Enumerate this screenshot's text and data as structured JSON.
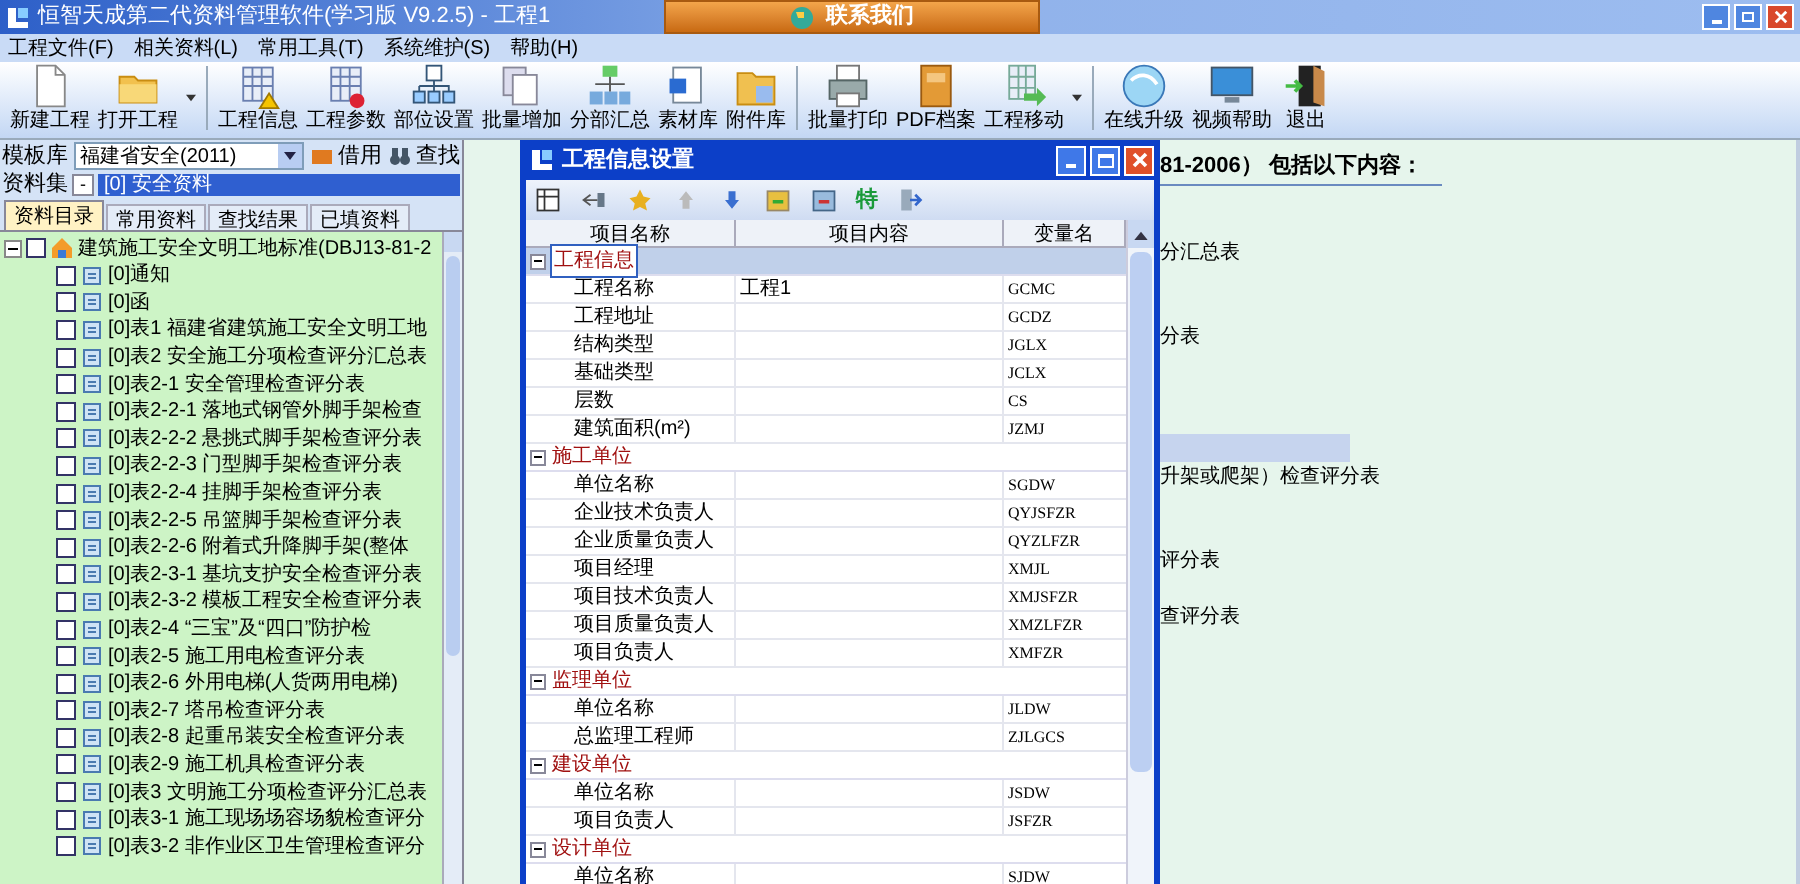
{
  "window": {
    "title": "恒智天成第二代资料管理软件(学习版 V9.2.5) - 工程1",
    "contact_button": "联系我们"
  },
  "menu": [
    "工程文件(F)",
    "相关资料(L)",
    "常用工具(T)",
    "系统维护(S)",
    "帮助(H)"
  ],
  "toolbar": [
    {
      "label": "新建工程"
    },
    {
      "label": "打开工程",
      "dropdown": true
    },
    {
      "label": "工程信息",
      "separator_before": true
    },
    {
      "label": "工程参数"
    },
    {
      "label": "部位设置"
    },
    {
      "label": "批量增加"
    },
    {
      "label": "分部汇总"
    },
    {
      "label": "素材库"
    },
    {
      "label": "附件库"
    },
    {
      "label": "批量打印",
      "separator_before": true
    },
    {
      "label": "PDF档案"
    },
    {
      "label": "工程移动",
      "dropdown": true
    },
    {
      "label": "在线升级",
      "separator_before": true
    },
    {
      "label": "视频帮助"
    },
    {
      "label": "退出"
    }
  ],
  "left_panel": {
    "template_label": "模板库",
    "template_value": "福建省安全(2011)",
    "borrow_button": "借用",
    "find_button": "查找",
    "set_label": "资料集",
    "set_toggle": "-",
    "set_value": "[0] 安全资料",
    "tabs": [
      {
        "label": "资料目录",
        "selected": true
      },
      {
        "label": "常用资料",
        "selected": false
      },
      {
        "label": "查找结果",
        "selected": false
      },
      {
        "label": "已填资料",
        "selected": false
      }
    ],
    "tree": {
      "label": "建筑施工安全文明工地标准(DBJ13-81-2",
      "expanded": true,
      "checked": false,
      "children": [
        {
          "label": "[0]通知",
          "checked": false
        },
        {
          "label": "[0]函",
          "checked": false
        },
        {
          "label": "[0]表1 福建省建筑施工安全文明工地",
          "checked": false
        },
        {
          "label": "[0]表2 安全施工分项检查评分汇总表",
          "checked": false
        },
        {
          "label": "[0]表2-1 安全管理检查评分表",
          "checked": false
        },
        {
          "label": "[0]表2-2-1 落地式钢管外脚手架检查",
          "checked": false
        },
        {
          "label": "[0]表2-2-2 悬挑式脚手架检查评分表",
          "checked": false
        },
        {
          "label": "[0]表2-2-3 门型脚手架检查评分表",
          "checked": false
        },
        {
          "label": "[0]表2-2-4 挂脚手架检查评分表",
          "checked": false
        },
        {
          "label": "[0]表2-2-5 吊篮脚手架检查评分表",
          "checked": false
        },
        {
          "label": "[0]表2-2-6 附着式升降脚手架(整体",
          "checked": false
        },
        {
          "label": "[0]表2-3-1 基坑支护安全检查评分表",
          "checked": false
        },
        {
          "label": "[0]表2-3-2 模板工程安全检查评分表",
          "checked": false
        },
        {
          "label": "[0]表2-4 “三宝”及“四口”防护检",
          "checked": false
        },
        {
          "label": "[0]表2-5 施工用电检查评分表",
          "checked": false
        },
        {
          "label": "[0]表2-6 外用电梯(人货两用电梯)",
          "checked": false
        },
        {
          "label": "[0]表2-7 塔吊检查评分表",
          "checked": false
        },
        {
          "label": "[0]表2-8 起重吊装安全检查评分表",
          "checked": false
        },
        {
          "label": "[0]表2-9 施工机具检查评分表",
          "checked": false
        },
        {
          "label": "[0]表3 文明施工分项检查评分汇总表",
          "checked": false
        },
        {
          "label": "[0]表3-1 施工现场场容场貌检查评分",
          "checked": false
        },
        {
          "label": "[0]表3-2 非作业区卫生管理检查评分",
          "checked": false
        }
      ]
    }
  },
  "content_lines": [
    {
      "text": "81-2006） 包括以下内容：",
      "selected": false
    },
    {
      "text": "分汇总表",
      "selected": false
    },
    {
      "text": "分表",
      "selected": false
    },
    {
      "selected": true
    },
    {
      "text": "升架或爬架）检查评分表",
      "selected": false
    },
    {
      "text": "评分表",
      "selected": false
    },
    {
      "text": "查评分表",
      "selected": false
    }
  ],
  "dialog": {
    "title": "工程信息设置",
    "toolbar_text_button": "特",
    "columns": [
      "项目名称",
      "项目内容",
      "变量名"
    ],
    "groups": [
      {
        "name": "工程信息",
        "expanded": true,
        "selected": true,
        "children": [
          {
            "name": "工程名称",
            "value": "工程1",
            "variable": "GCMC"
          },
          {
            "name": "工程地址",
            "variable": "GCDZ"
          },
          {
            "name": "结构类型",
            "variable": "JGLX"
          },
          {
            "name": "基础类型",
            "variable": "JCLX"
          },
          {
            "name": "层数",
            "variable": "CS"
          },
          {
            "name": "建筑面积(m²)",
            "variable": "JZMJ"
          }
        ]
      },
      {
        "name": "施工单位",
        "expanded": true,
        "selected": false,
        "children": [
          {
            "name": "单位名称",
            "variable": "SGDW"
          },
          {
            "name": "企业技术负责人",
            "variable": "QYJSFZR"
          },
          {
            "name": "企业质量负责人",
            "variable": "QYZLFZR"
          },
          {
            "name": "项目经理",
            "variable": "XMJL"
          },
          {
            "name": "项目技术负责人",
            "variable": "XMJSFZR"
          },
          {
            "name": "项目质量负责人",
            "variable": "XMZLFZR"
          },
          {
            "name": "项目负责人",
            "variable": "XMFZR"
          }
        ]
      },
      {
        "name": "监理单位",
        "expanded": true,
        "selected": false,
        "children": [
          {
            "name": "单位名称",
            "variable": "JLDW"
          },
          {
            "name": "总监理工程师",
            "variable": "ZJLGCS"
          }
        ]
      },
      {
        "name": "建设单位",
        "expanded": true,
        "selected": false,
        "children": [
          {
            "name": "单位名称",
            "variable": "JSDW"
          },
          {
            "name": "项目负责人",
            "variable": "JSFZR"
          }
        ]
      },
      {
        "name": "设计单位",
        "expanded": true,
        "selected": false,
        "children": [
          {
            "name": "单位名称",
            "variable": "SJDW"
          }
        ]
      }
    ]
  }
}
